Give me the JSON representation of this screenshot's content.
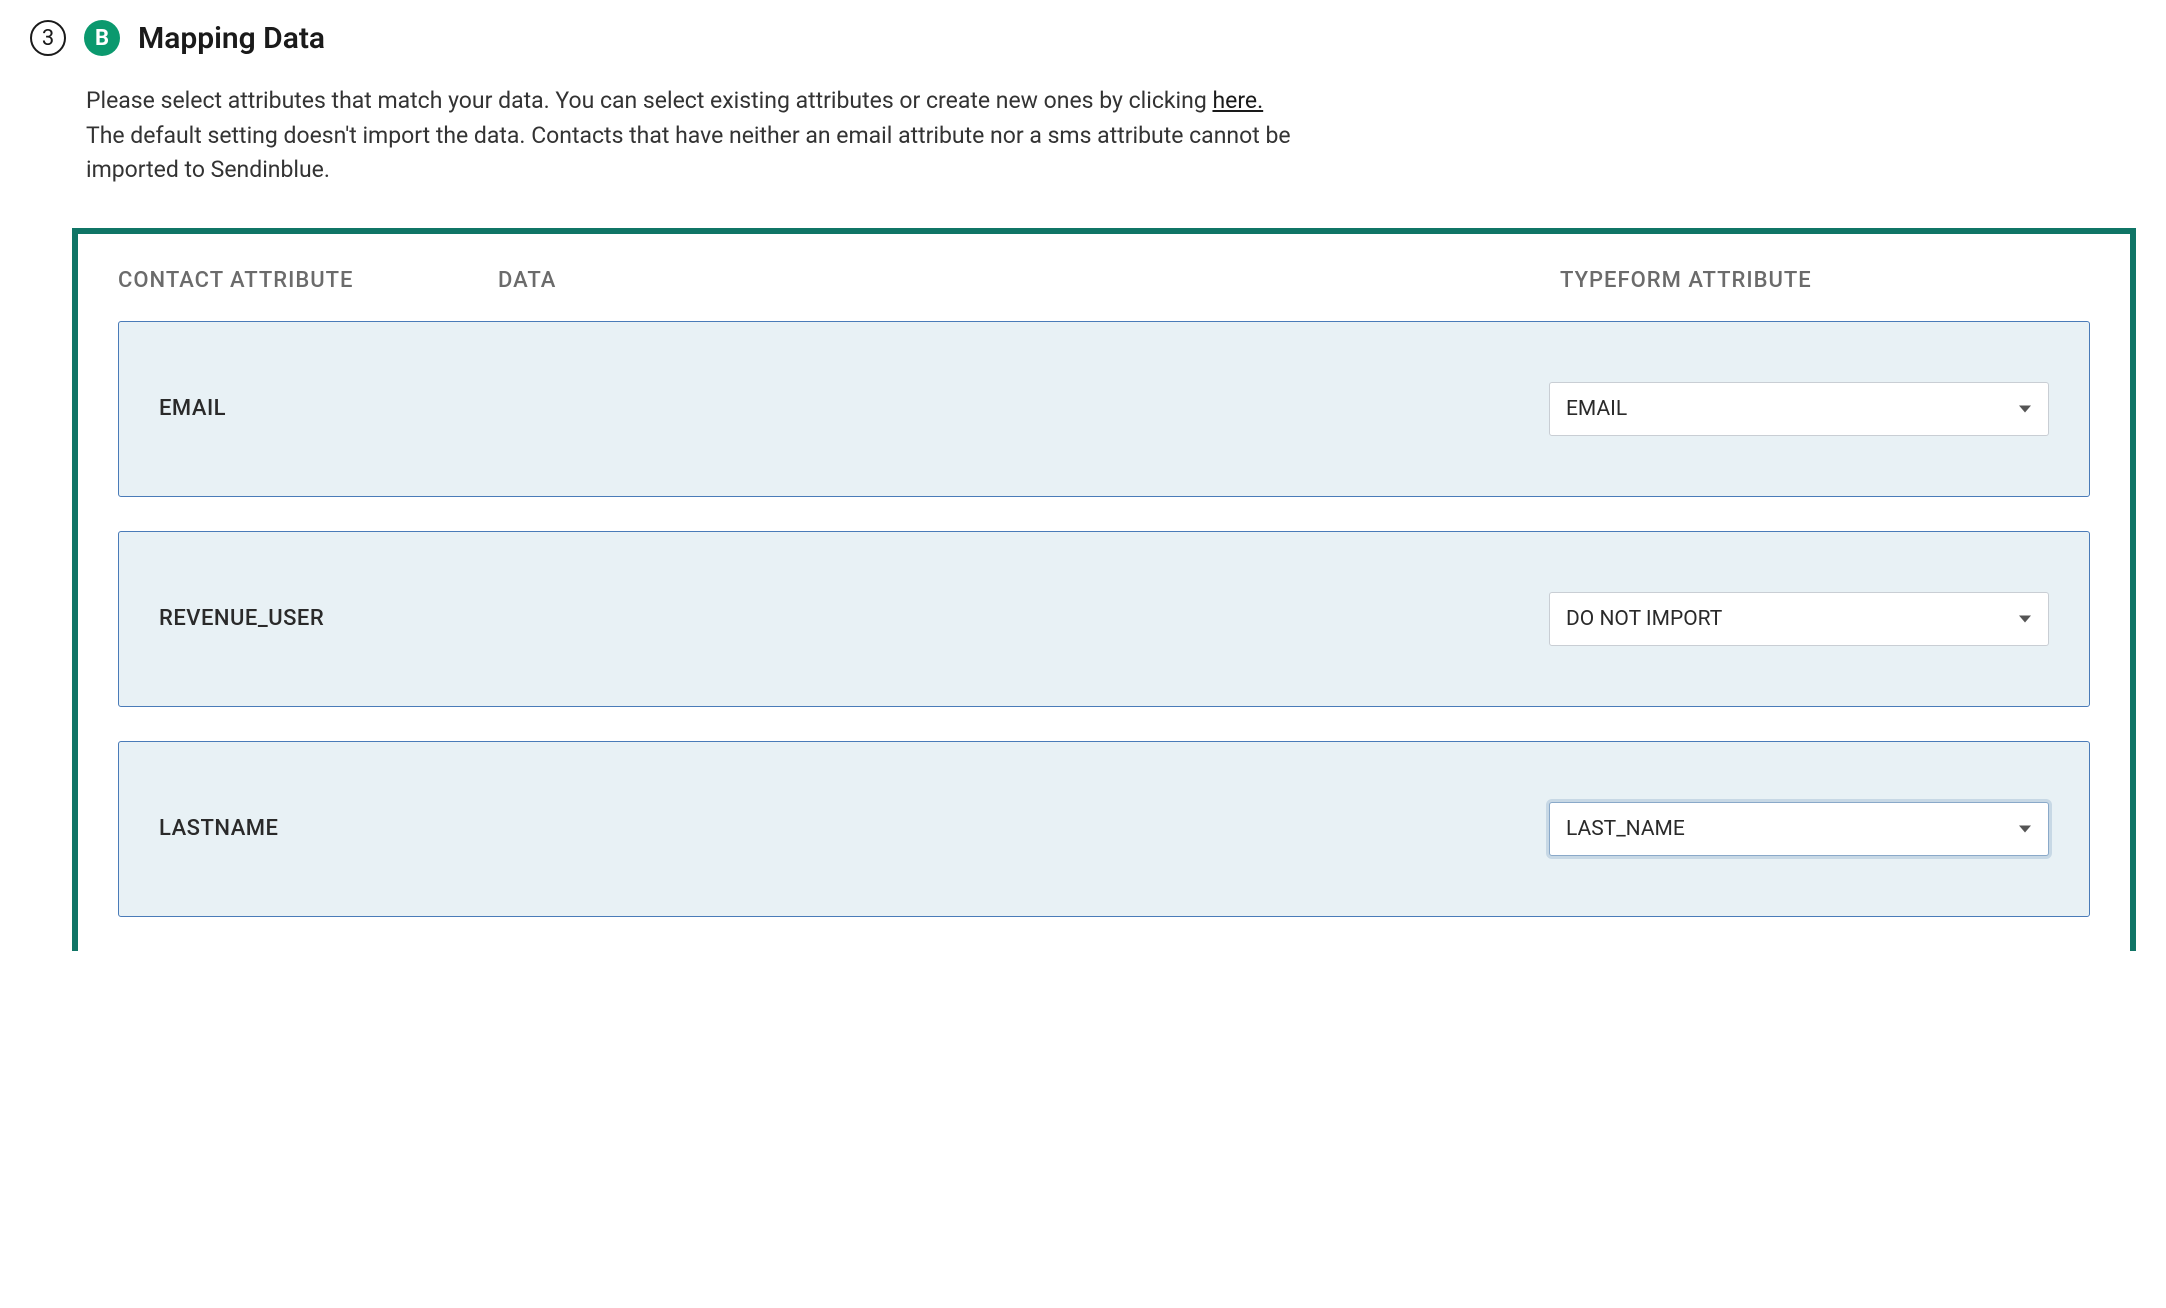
{
  "step": {
    "number": "3",
    "brand_letter": "B",
    "title": "Mapping Data"
  },
  "description": {
    "line1_before_link": "Please select attributes that match your data. You can select existing attributes or create new ones by clicking ",
    "link_text": "here.",
    "line2": "The default setting doesn't import the data. Contacts that have neither an email attribute nor a sms attribute cannot be imported to Sendinblue."
  },
  "columns": {
    "contact": "CONTACT ATTRIBUTE",
    "data": "DATA",
    "typeform": "TYPEFORM ATTRIBUTE"
  },
  "rows": [
    {
      "contact_attribute": "EMAIL",
      "typeform_value": "EMAIL",
      "focused": false
    },
    {
      "contact_attribute": "REVENUE_USER",
      "typeform_value": "DO NOT IMPORT",
      "focused": false
    },
    {
      "contact_attribute": "LASTNAME",
      "typeform_value": "LAST_NAME",
      "focused": true
    }
  ]
}
